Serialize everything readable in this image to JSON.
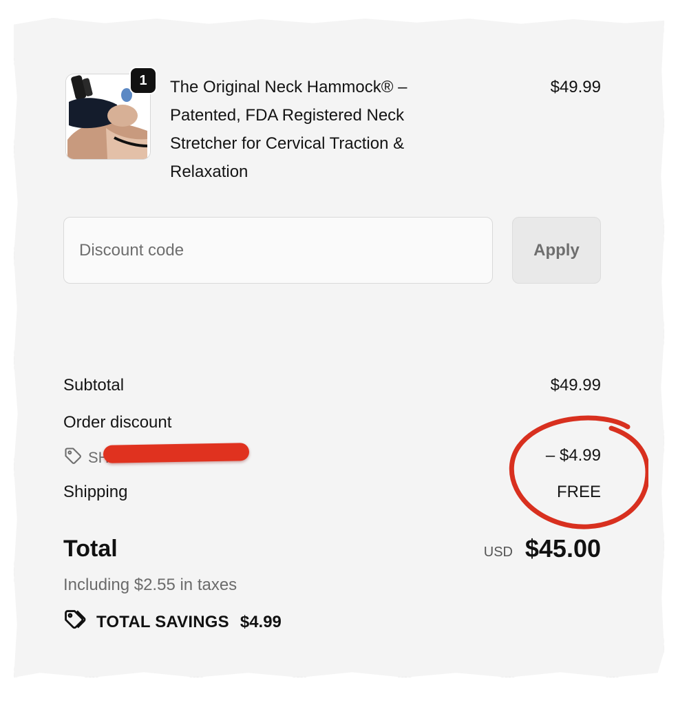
{
  "product": {
    "image_alt": "neck-hammock-product-photo",
    "quantity": "1",
    "title": "The Original Neck Hammock® – Patented, FDA Registered Neck Stretcher for Cervical Traction & Relaxation",
    "price": "$49.99"
  },
  "discount": {
    "placeholder": "Discount code",
    "value": "",
    "apply_label": "Apply"
  },
  "summary": {
    "subtotal_label": "Subtotal",
    "subtotal_value": "$49.99",
    "order_discount_label": "Order discount",
    "discount_code_prefix": "SH",
    "discount_value": "– $4.99",
    "shipping_label": "Shipping",
    "shipping_value": "FREE",
    "total_label": "Total",
    "total_currency": "USD",
    "total_value": "$45.00",
    "tax_note": "Including $2.55 in taxes",
    "savings_label": "TOTAL SAVINGS",
    "savings_value": "$4.99"
  },
  "annotations": {
    "circle_color": "#d8301f",
    "redaction_color": "#e0321f"
  },
  "icons": {
    "discount_tag": "tag-icon",
    "savings_tag": "tags-icon"
  }
}
